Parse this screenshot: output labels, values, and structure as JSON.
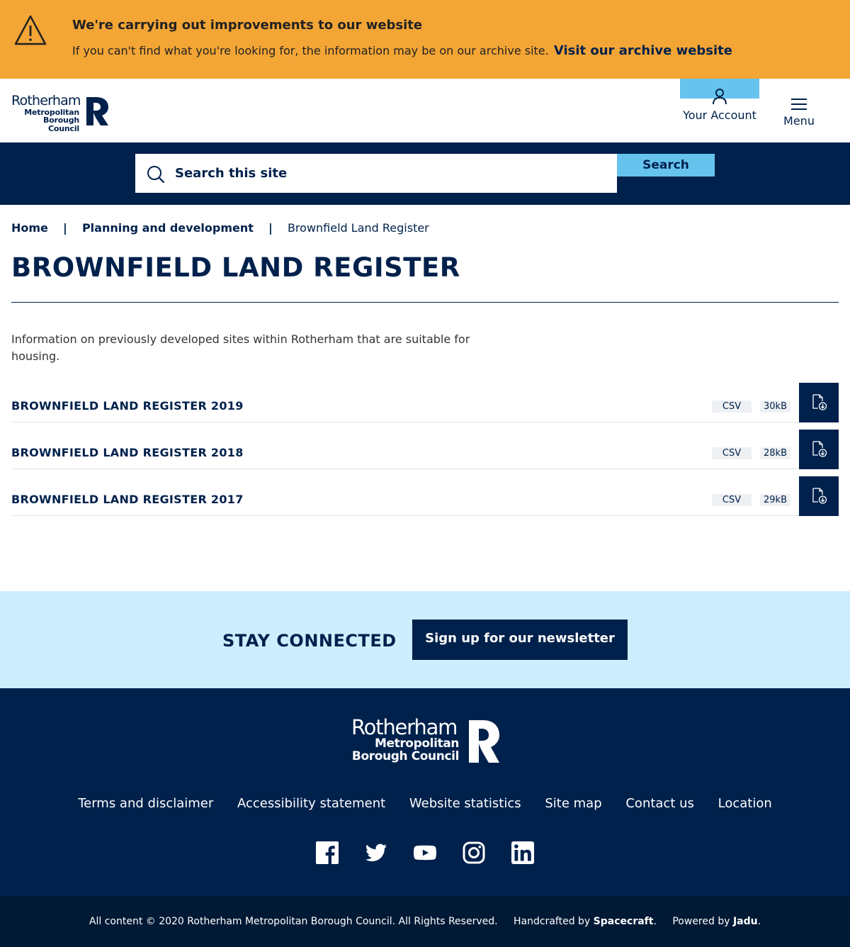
{
  "alert": {
    "title": "We're carrying out improvements to our website",
    "text": "If you can't find what you're looking for, the information may be on our archive site.",
    "link": "Visit our archive website",
    "icon": "warning-icon"
  },
  "header": {
    "logo": {
      "line1": "Rotherham",
      "line2": "Metropolitan",
      "line3": "Borough Council"
    },
    "account_label": "Your Account",
    "menu_label": "Menu"
  },
  "search": {
    "placeholder": "Search this site",
    "button": "Search"
  },
  "breadcrumb": {
    "home": "Home",
    "section": "Planning and development",
    "current": "Brownfield Land Register",
    "separator": "|"
  },
  "page": {
    "title": "BROWNFIELD LAND REGISTER",
    "intro": "Information on previously developed sites within Rotherham that are suitable for housing."
  },
  "documents": [
    {
      "title": "BROWNFIELD LAND REGISTER 2019",
      "type": "CSV",
      "size": "30kB"
    },
    {
      "title": "BROWNFIELD LAND REGISTER 2018",
      "type": "CSV",
      "size": "28kB"
    },
    {
      "title": "BROWNFIELD LAND REGISTER 2017",
      "type": "CSV",
      "size": "29kB"
    }
  ],
  "connected": {
    "title": "STAY CONNECTED",
    "button": "Sign up for our newsletter"
  },
  "footer": {
    "logo": {
      "line1": "Rotherham",
      "line2": "Metropolitan",
      "line3": "Borough Council"
    },
    "links": [
      "Terms and disclaimer",
      "Accessibility statement",
      "Website statistics",
      "Site map",
      "Contact us",
      "Location"
    ],
    "social": [
      "facebook-icon",
      "twitter-icon",
      "youtube-icon",
      "instagram-icon",
      "linkedin-icon"
    ],
    "copyright": "All content © 2020 Rotherham Metropolitan Borough Council. All Rights Reserved.",
    "handcrafted_prefix": "Handcrafted by",
    "handcrafted_name": "Spacecraft",
    "powered_prefix": "Powered by",
    "powered_name": "Jadu",
    "period": "."
  },
  "colors": {
    "brand_navy": "#00214c",
    "alert_orange": "#f3a535",
    "accent_light_blue": "#66c3ee",
    "connected_bg": "#cceefd"
  }
}
